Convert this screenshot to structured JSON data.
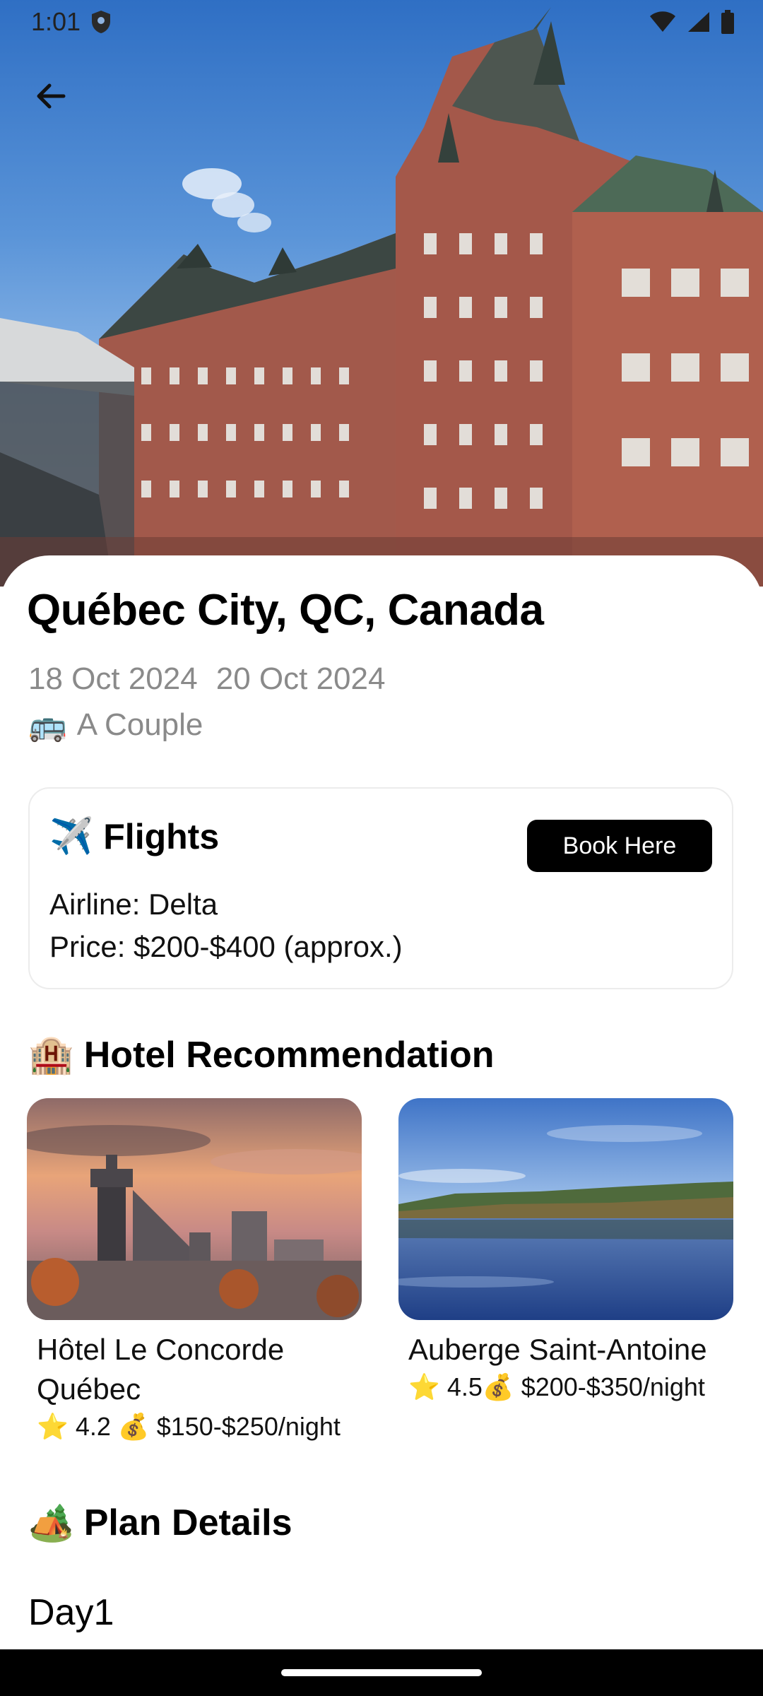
{
  "status_bar": {
    "time": "1:01",
    "icons": [
      "shield-icon",
      "wifi-icon",
      "signal-icon",
      "battery-icon"
    ]
  },
  "header": {
    "back_icon": "arrow-left-icon",
    "hero_image": "Château Frontenac photo"
  },
  "trip": {
    "title": "Québec City, QC, Canada",
    "start_date": "18 Oct 2024",
    "end_date": "20 Oct 2024",
    "traveler_emoji": "🚌",
    "traveler": "A Couple"
  },
  "flights": {
    "emoji": "✈️",
    "title": "Flights",
    "book_label": "Book Here",
    "airline": "Airline: Delta",
    "price": "Price: $200-$400 (approx.)"
  },
  "hotels": {
    "emoji": "🏨",
    "title": "Hotel Recommendation",
    "items": [
      {
        "name": "Hôtel Le Concorde Québec",
        "meta": "⭐ 4.2 💰 $150-$250/night"
      },
      {
        "name": "Auberge Saint-Antoine",
        "meta": "⭐ 4.5💰 $200-$350/night"
      }
    ]
  },
  "plan": {
    "emoji": "🏕️",
    "title": "Plan Details",
    "day_label": "Day1"
  },
  "colors": {
    "accent": "#000000",
    "muted_text": "#8a8a8a",
    "card_border": "#ececec"
  }
}
